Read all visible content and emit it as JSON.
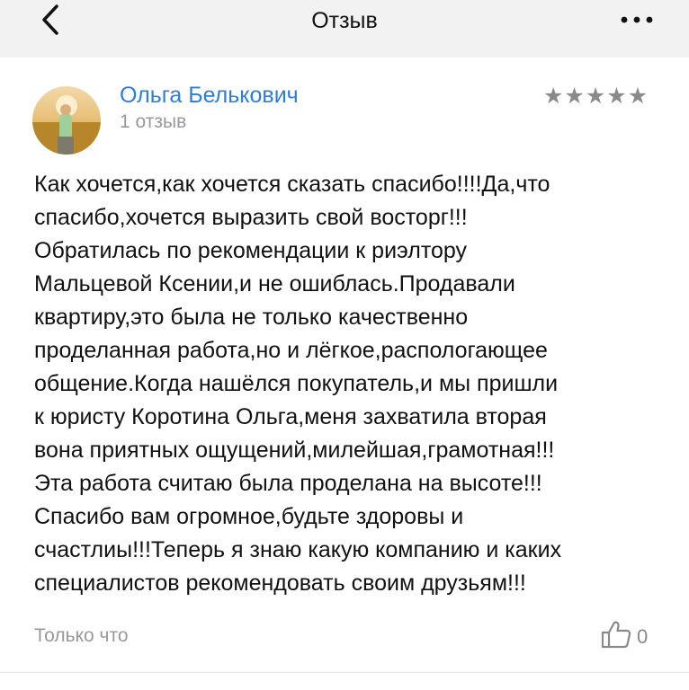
{
  "header": {
    "title": "Отзыв",
    "back_icon": "chevron-left-icon",
    "more_icon": "more-horizontal-icon"
  },
  "review": {
    "author_name": "Ольга Белькович",
    "author_review_count": "1 отзыв",
    "rating": 5,
    "rating_max": 5,
    "text": "Как хочется,как хочется сказать спасибо!!!!Да,что\nспасибо,хочется выразить свой восторг!!!\nОбратилась по рекомендации к риэлтору\nМальцевой Ксении,и не ошиблась.Продавали\nквартиру,это была не только качественно\nпроделанная работа,но и лёгкое,распологающее\nобщение.Когда нашёлся покупатель,и мы пришли\nк юристу Коротина Ольга,меня захватила вторая\nвона приятных ощущений,милейшая,грамотная!!!\nЭта работа считаю была проделана на высоте!!!\nСпасибо вам огромное,будьте здоровы и\nсчастлиы!!!Теперь я знаю какую компанию и каких\nспециалистов рекомендовать своим друзьям!!!",
    "timestamp": "Только что",
    "like_count": "0",
    "like_icon": "thumbs-up-icon"
  },
  "colors": {
    "header_bg": "#f2f2f2",
    "author_link": "#2b7de0",
    "secondary_text": "#999999",
    "star": "#8a8a8a"
  }
}
